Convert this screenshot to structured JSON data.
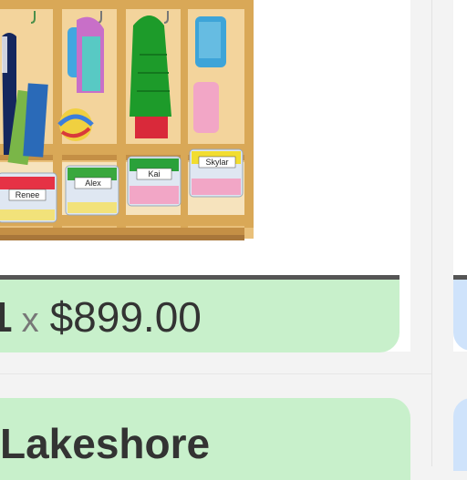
{
  "product": {
    "image_alt": "Classroom cubby coat locker with labeled storage bins",
    "bin_labels": [
      "Renee",
      "Alex",
      "Kai",
      "Skylar"
    ],
    "quantity": "1",
    "times_symbol": "x",
    "price": "$899.00",
    "vendor": "Lakeshore"
  },
  "colors": {
    "price_bar": "#c8f0cb",
    "neighbor_card": "#cfe3fb",
    "text": "#333333"
  }
}
